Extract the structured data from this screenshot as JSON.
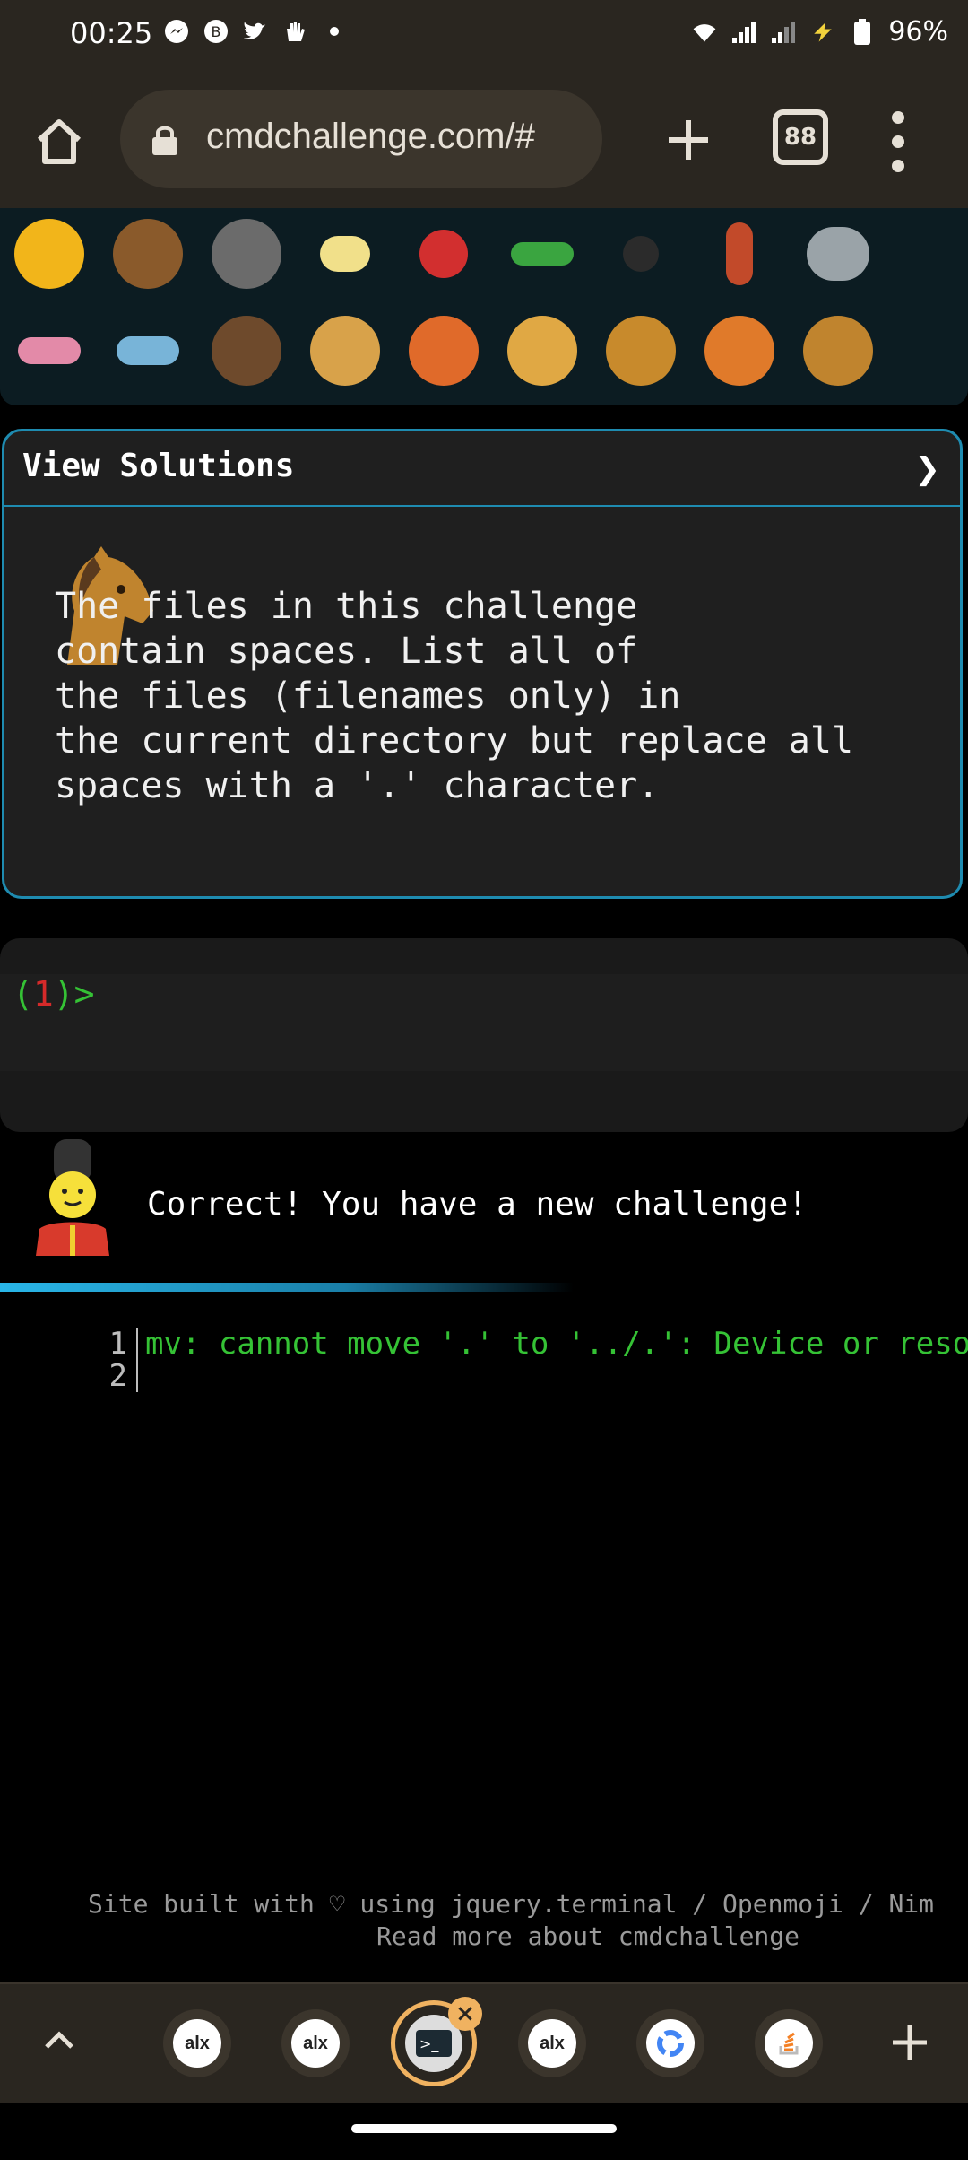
{
  "status_bar": {
    "time": "00:25",
    "battery": "96%",
    "left_icons": [
      "messenger-icon",
      "b-icon",
      "twitter-icon",
      "wave-icon",
      "dot-icon"
    ],
    "right_icons": [
      "wifi-icon",
      "signal-icon",
      "signal-icon",
      "charging-icon",
      "battery-icon"
    ]
  },
  "browser": {
    "url": "cmdchallenge.com/#",
    "tab_count": "88"
  },
  "animals": {
    "row1": [
      "tropical-fish",
      "pufferfish",
      "wolf",
      "bee",
      "ladybug",
      "cricket",
      "spider",
      "scorpion",
      "fly"
    ],
    "row2": [
      "worm",
      "microbe",
      "monkey",
      "dog",
      "fox",
      "cat",
      "lion",
      "tiger",
      "horse"
    ]
  },
  "solution_panel": {
    "title": "View Solutions",
    "chevron": "❯",
    "challenge_text": "The files in this challenge\ncontain spaces. List all of\nthe files (filenames only) in\nthe current directory but replace all\nspaces with a '.' character."
  },
  "terminal": {
    "prompt_open": "(",
    "prompt_num": "1",
    "prompt_close": ")>"
  },
  "result": {
    "message": "Correct! You have a new challenge!"
  },
  "output": {
    "line_numbers": "1\n2",
    "text": "mv: cannot move '.' to '../.': Device or resource busy"
  },
  "footer": {
    "line1": "Site built with ♡ using jquery.terminal / Openmoji / Nim",
    "line2": "Read more about cmdchallenge"
  },
  "tab_strip": {
    "tabs": [
      "alx",
      "alx",
      "terminal",
      "alx",
      "google",
      "stackoverflow"
    ]
  }
}
